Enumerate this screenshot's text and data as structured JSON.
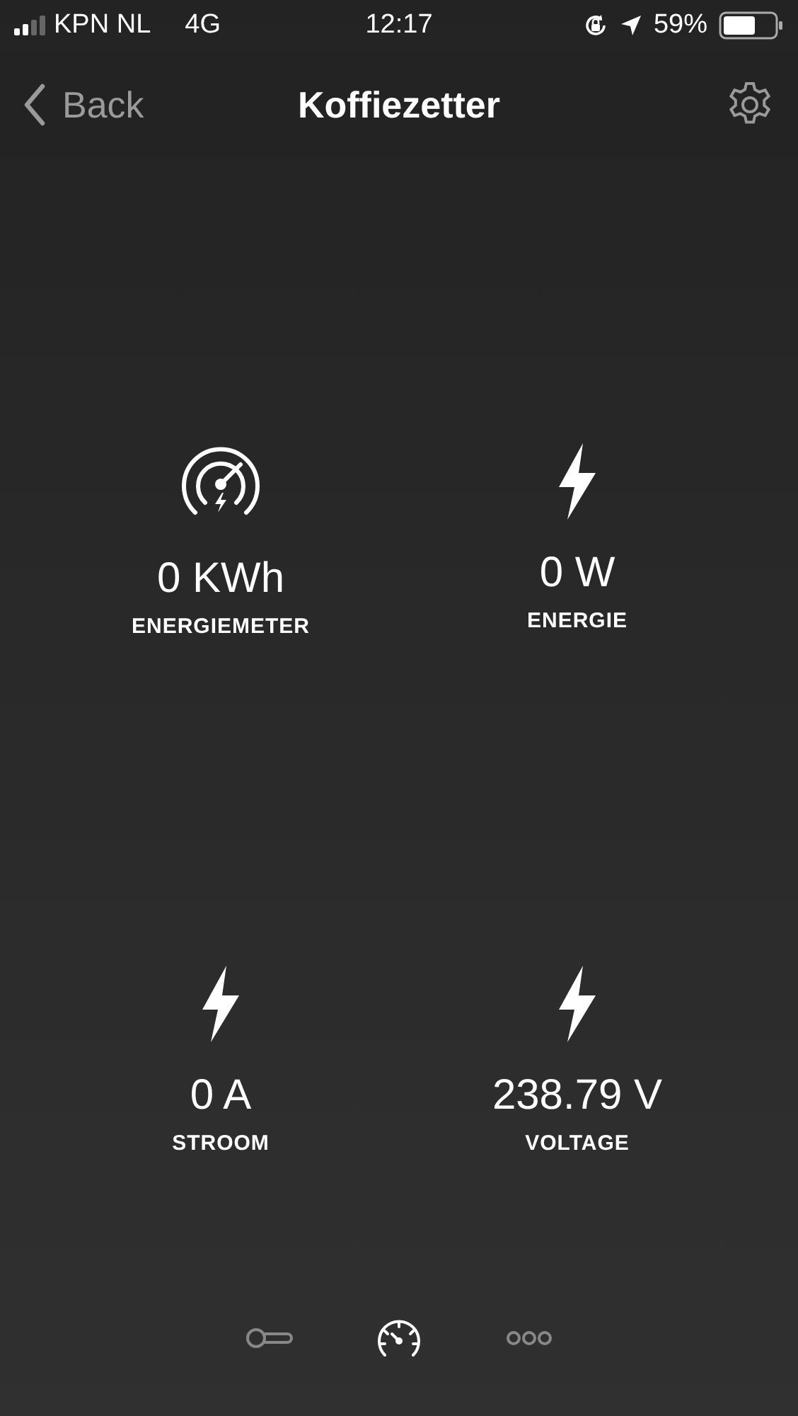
{
  "status_bar": {
    "carrier": "KPN NL",
    "network": "4G",
    "time": "12:17",
    "battery": "59%"
  },
  "nav": {
    "back": "Back",
    "title": "Koffiezetter"
  },
  "tiles": [
    {
      "kind": "meter",
      "value": "0 KWh",
      "label": "ENERGIEMETER"
    },
    {
      "kind": "bolt",
      "value": "0 W",
      "label": "ENERGIE"
    },
    {
      "kind": "bolt",
      "value": "0 A",
      "label": "STROOM"
    },
    {
      "kind": "bolt",
      "value": "238.79 V",
      "label": "VOLTAGE"
    }
  ],
  "tab_bar": [
    {
      "kind": "switch",
      "selected": false
    },
    {
      "kind": "gauge",
      "selected": true
    },
    {
      "kind": "more",
      "selected": false
    }
  ]
}
